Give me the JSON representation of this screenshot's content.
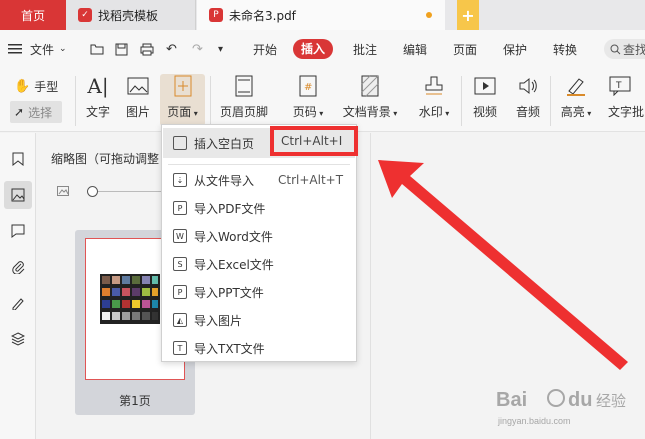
{
  "tabs": {
    "home": "首页",
    "t1": "找稻壳模板",
    "t2": "未命名3.pdf"
  },
  "menubar": {
    "file": "文件",
    "items": [
      "开始",
      "插入",
      "批注",
      "编辑",
      "页面",
      "保护",
      "转换"
    ],
    "search": "查找"
  },
  "ribbon": {
    "hand": "手型",
    "select": "选择",
    "text": "文字",
    "image": "图片",
    "page": "页面",
    "header_footer": "页眉页脚",
    "page_number": "页码",
    "doc_background": "文档背景",
    "watermark": "水印",
    "video": "视频",
    "audio": "音频",
    "highlight": "高亮",
    "text_annot": "文字批"
  },
  "thumbnails": {
    "title": "缩略图（可拖动调整",
    "page1_label": "第1页"
  },
  "dropdown": {
    "items": [
      {
        "label": "插入空白页",
        "shortcut": "Ctrl+Alt+I"
      },
      {
        "label": "从文件导入",
        "shortcut": "Ctrl+Alt+T"
      },
      {
        "label": "导入PDF文件",
        "shortcut": ""
      },
      {
        "label": "导入Word文件",
        "shortcut": ""
      },
      {
        "label": "导入Excel文件",
        "shortcut": ""
      },
      {
        "label": "导入PPT文件",
        "shortcut": ""
      },
      {
        "label": "导入图片",
        "shortcut": ""
      },
      {
        "label": "导入TXT文件",
        "shortcut": ""
      }
    ]
  },
  "watermark": {
    "brand": "Bai du 经验",
    "url": "jingyan.baidu.com"
  },
  "colors": {
    "accent": "#d93636",
    "highlight_box": "#ee3030"
  }
}
